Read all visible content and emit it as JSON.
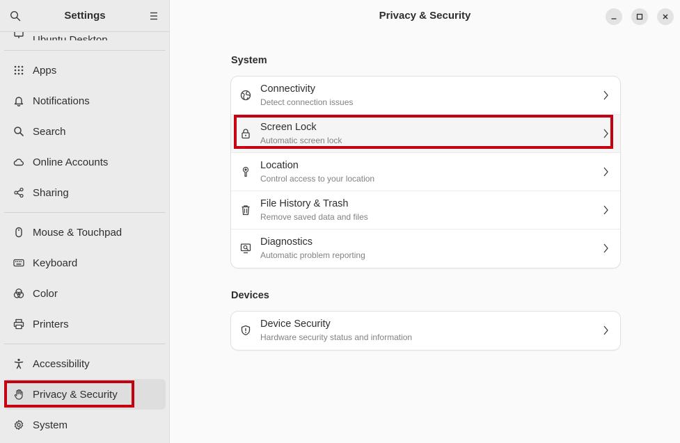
{
  "sidebar": {
    "title": "Settings",
    "partial_item": "Ubuntu Desktop",
    "groups": [
      [
        {
          "label": "Apps",
          "icon": "apps-grid-icon"
        },
        {
          "label": "Notifications",
          "icon": "bell-icon"
        },
        {
          "label": "Search",
          "icon": "search-icon"
        },
        {
          "label": "Online Accounts",
          "icon": "cloud-icon"
        },
        {
          "label": "Sharing",
          "icon": "share-icon"
        }
      ],
      [
        {
          "label": "Mouse & Touchpad",
          "icon": "mouse-icon"
        },
        {
          "label": "Keyboard",
          "icon": "keyboard-icon"
        },
        {
          "label": "Color",
          "icon": "color-icon"
        },
        {
          "label": "Printers",
          "icon": "printer-icon"
        }
      ],
      [
        {
          "label": "Accessibility",
          "icon": "accessibility-icon"
        },
        {
          "label": "Privacy & Security",
          "icon": "hand-icon",
          "active": true
        },
        {
          "label": "System",
          "icon": "gear-icon"
        }
      ]
    ]
  },
  "main": {
    "title": "Privacy & Security",
    "sections": [
      {
        "title": "System",
        "rows": [
          {
            "title": "Connectivity",
            "subtitle": "Detect connection issues",
            "icon": "globe-icon"
          },
          {
            "title": "Screen Lock",
            "subtitle": "Automatic screen lock",
            "icon": "lock-icon",
            "highlighted": true
          },
          {
            "title": "Location",
            "subtitle": "Control access to your location",
            "icon": "location-pin-icon"
          },
          {
            "title": "File History & Trash",
            "subtitle": "Remove saved data and files",
            "icon": "trash-icon"
          },
          {
            "title": "Diagnostics",
            "subtitle": "Automatic problem reporting",
            "icon": "diagnostics-icon"
          }
        ]
      },
      {
        "title": "Devices",
        "rows": [
          {
            "title": "Device Security",
            "subtitle": "Hardware security status and information",
            "icon": "shield-icon"
          }
        ]
      }
    ]
  },
  "colors": {
    "highlight": "#c40011",
    "sidebar_bg": "#ebebeb",
    "content_bg": "#fafafa"
  }
}
